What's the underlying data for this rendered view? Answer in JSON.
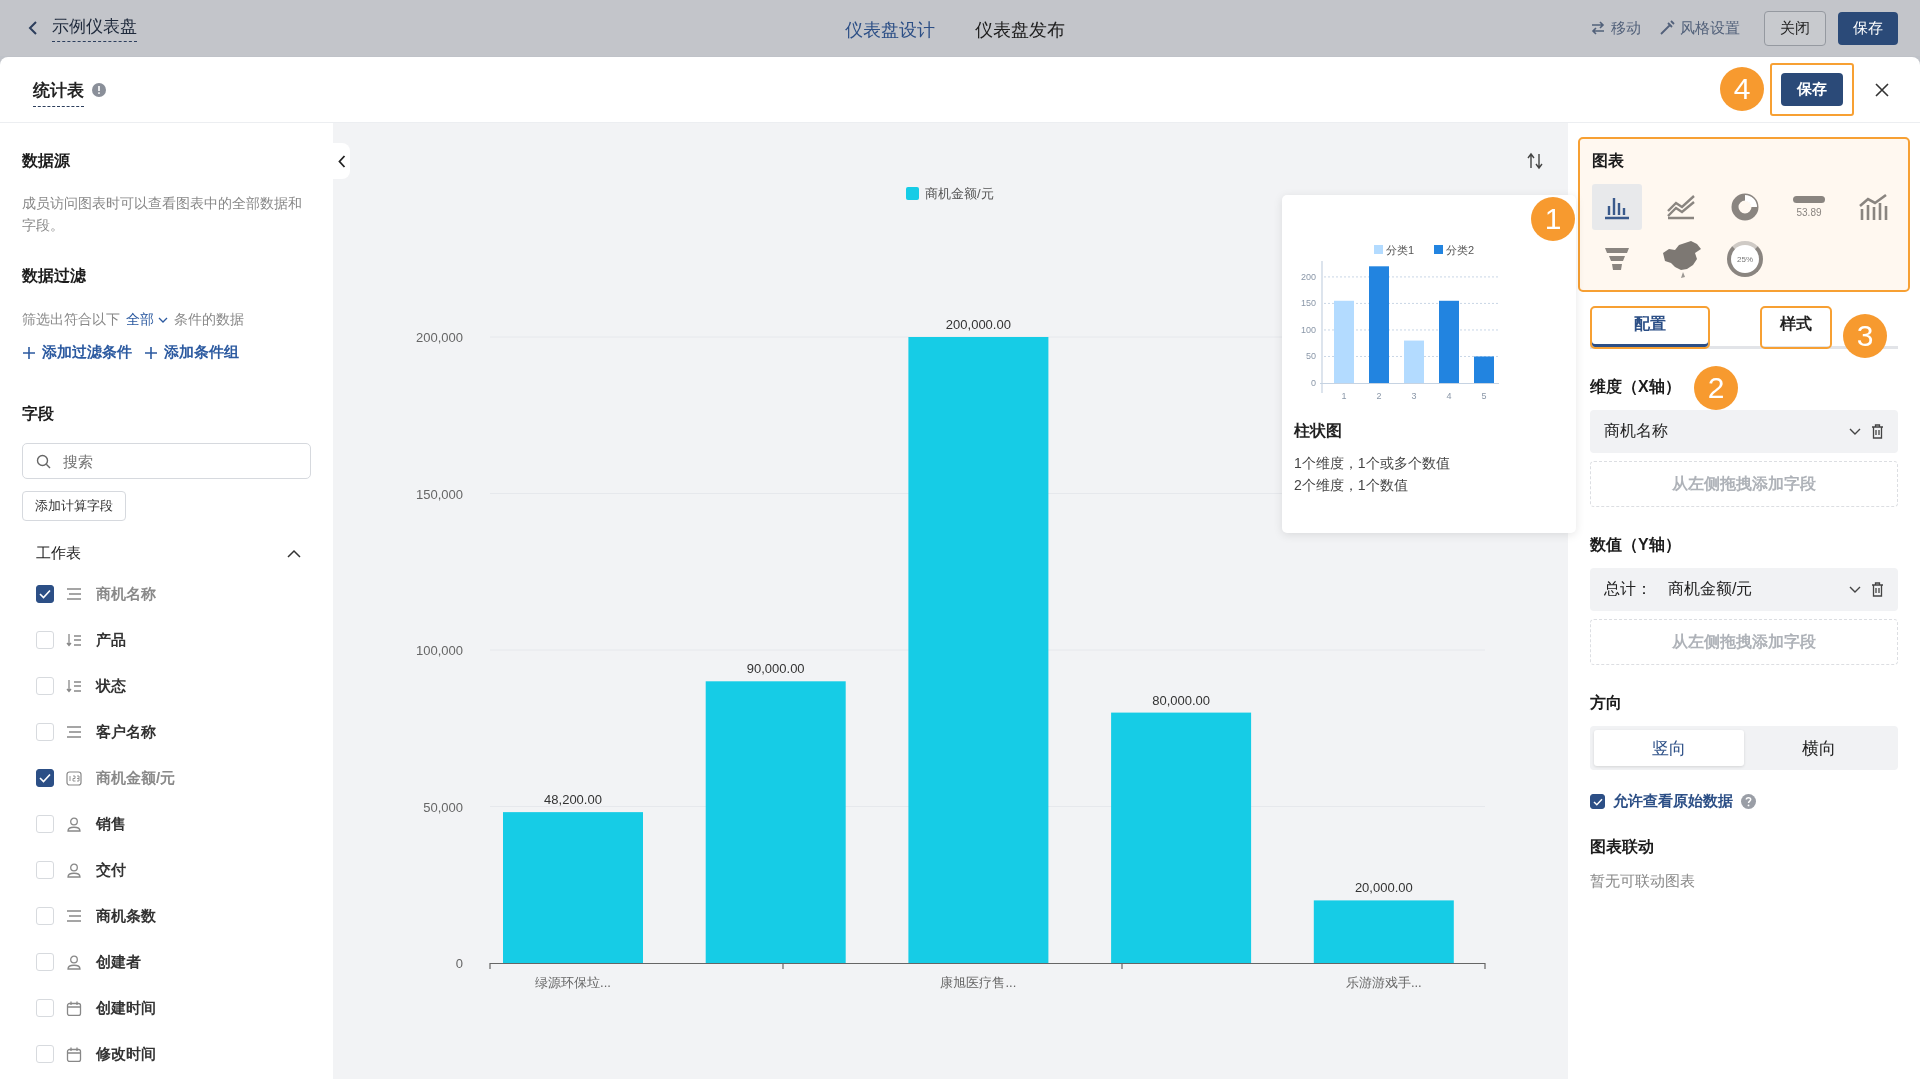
{
  "topbar": {
    "back_label": "示例仪表盘",
    "tabs": [
      {
        "label": "仪表盘设计",
        "selected": true
      },
      {
        "label": "仪表盘发布",
        "selected": false
      }
    ],
    "actions": [
      {
        "kind": "move",
        "label": "移动"
      },
      {
        "kind": "style",
        "label": "风格设置"
      }
    ],
    "buttons": [
      {
        "kind": "outline",
        "label": "关闭"
      },
      {
        "kind": "primary",
        "label": "保存"
      }
    ]
  },
  "dialog": {
    "title": "统计表",
    "save_button": {
      "label": "保存",
      "highlighted": true
    }
  },
  "left_panel": {
    "source_title": "数据源",
    "source_desc": "成员访问图表时可以查看图表中的全部数据和字段。",
    "filter_title": "数据过滤",
    "filter_prefix": "筛选出符合以下",
    "filter_mode": "全部",
    "filter_suffix": "条件的数据",
    "filter_buttons": [
      "添加过滤条件",
      "添加条件组"
    ],
    "fields_title": "字段",
    "search": {
      "placeholder": "搜索"
    },
    "calc_button": "添加计算字段",
    "group": {
      "label": "工作表",
      "expanded": true
    },
    "fields": [
      {
        "label": "商机名称",
        "kind": "text",
        "checked": true
      },
      {
        "label": "产品",
        "kind": "sort",
        "checked": false
      },
      {
        "label": "状态",
        "kind": "sort",
        "checked": false
      },
      {
        "label": "客户名称",
        "kind": "text",
        "checked": false
      },
      {
        "label": "商机金额/元",
        "kind": "number",
        "checked": true
      },
      {
        "label": "销售",
        "kind": "person",
        "checked": false
      },
      {
        "label": "交付",
        "kind": "person",
        "checked": false
      },
      {
        "label": "商机条数",
        "kind": "text",
        "checked": false
      },
      {
        "label": "创建者",
        "kind": "person",
        "checked": false
      },
      {
        "label": "创建时间",
        "kind": "date",
        "checked": false
      },
      {
        "label": "修改时间",
        "kind": "date",
        "checked": false
      }
    ]
  },
  "chart": {
    "chart_data": {
      "type": "bar",
      "ylim": [
        0,
        200000
      ],
      "grid": true,
      "legend": "top",
      "yticks": [
        {
          "value": 0,
          "label": "0"
        },
        {
          "value": 50000,
          "label": "50,000"
        },
        {
          "value": 100000,
          "label": "100,000"
        },
        {
          "value": 150000,
          "label": "150,000"
        },
        {
          "value": 200000,
          "label": "200,000"
        }
      ],
      "categories": [
        "绿源环保垃...",
        null,
        "康旭医疗售...",
        null,
        "乐游游戏手..."
      ],
      "series": [
        {
          "name": "商机金额/元",
          "color": "#16cce6",
          "values": [
            48200,
            90000,
            200000,
            80000,
            20000
          ]
        }
      ],
      "value_labels": [
        "48,200.00",
        "90,000.00",
        "200,000.00",
        "80,000.00",
        "20,000.00"
      ]
    }
  },
  "preview_card": {
    "title": "柱状图",
    "lines": [
      "1个维度，1个或多个数值",
      "2个维度，1个数值"
    ],
    "chart_data": {
      "type": "bar",
      "categories": [
        "1",
        "2",
        "3",
        "4",
        "5"
      ],
      "ylim": [
        0,
        230
      ],
      "grid": true,
      "legend": "top",
      "yticks": [
        0,
        50,
        100,
        150,
        200
      ],
      "series": [
        {
          "name": "分类1",
          "color": "#b3dbff",
          "values": [
            155,
            null,
            80,
            null,
            null
          ]
        },
        {
          "name": "分类2",
          "color": "#2284e0",
          "values": [
            null,
            220,
            null,
            155,
            50
          ]
        }
      ]
    }
  },
  "right_panel": {
    "picker_title": "图表",
    "picker_highlighted": true,
    "chart_types": [
      {
        "kind": "bar",
        "selected": true
      },
      {
        "kind": "line",
        "selected": false
      },
      {
        "kind": "donut",
        "selected": false
      },
      {
        "kind": "stat",
        "selected": false,
        "label": "53.89"
      },
      {
        "kind": "combo",
        "selected": false
      },
      {
        "kind": "funnel",
        "selected": false
      },
      {
        "kind": "map",
        "selected": false
      },
      {
        "kind": "ring",
        "selected": false,
        "label": "25%"
      }
    ],
    "tabs": [
      {
        "label": "配置",
        "selected": true,
        "highlighted": true
      },
      {
        "label": "样式",
        "selected": false,
        "highlighted": true
      }
    ],
    "sections": [
      {
        "title": "维度（X轴）",
        "field": "商机名称",
        "dropzone": "从左侧拖拽添加字段"
      },
      {
        "title": "数值（Y轴）",
        "field_prefix": "总计：",
        "field": "商机金额/元",
        "dropzone": "从左侧拖拽添加字段"
      }
    ],
    "direction_title": "方向",
    "directions": [
      {
        "label": "竖向",
        "selected": true
      },
      {
        "label": "横向",
        "selected": false
      }
    ],
    "raw_data": {
      "label": "允许查看原始数据",
      "checked": true
    },
    "linkage_title": "图表联动",
    "linkage_empty": "暂无可联动图表"
  },
  "annotations": [
    "1",
    "2",
    "3",
    "4"
  ]
}
